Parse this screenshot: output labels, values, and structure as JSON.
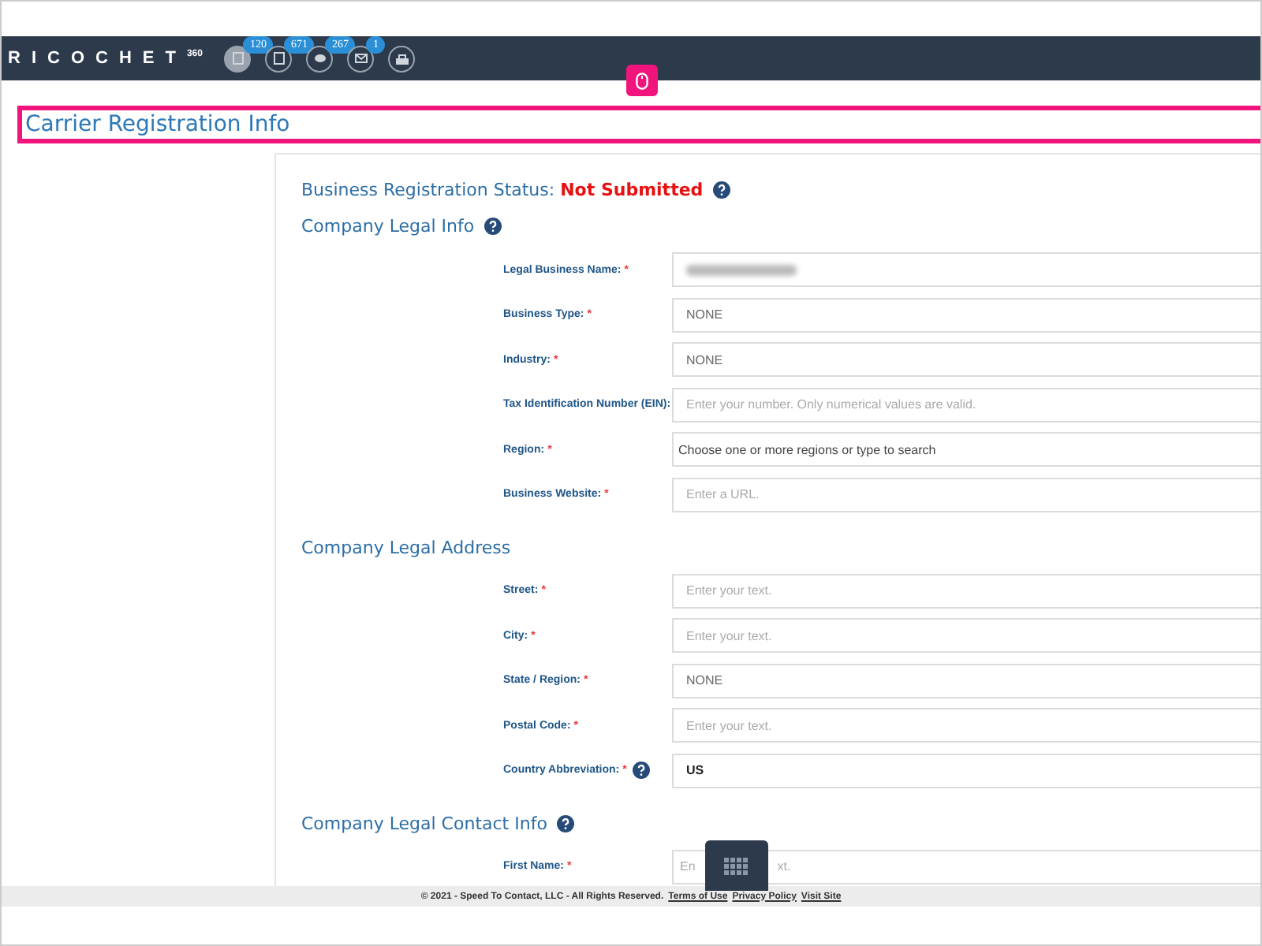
{
  "header": {
    "logo": "RICOCHET",
    "logo_sup": "360",
    "icons": [
      {
        "kind": "doc",
        "badge": "120",
        "selected": true
      },
      {
        "kind": "doc",
        "badge": "671",
        "selected": false
      },
      {
        "kind": "chat",
        "badge": "267",
        "selected": false
      },
      {
        "kind": "mail",
        "badge": "1",
        "selected": false
      },
      {
        "kind": "tray",
        "selected": false
      }
    ]
  },
  "page_title": "Carrier Registration Info",
  "status": {
    "label": "Business Registration Status:",
    "value": "Not Submitted"
  },
  "sections": [
    {
      "title": "Company Legal Info",
      "help": true,
      "fields": [
        {
          "label": "Legal Business Name:",
          "mark": "*",
          "kind": "blurred"
        },
        {
          "label": "Business Type:",
          "mark": "*",
          "kind": "select",
          "value": "NONE"
        },
        {
          "label": "Industry:",
          "mark": "*",
          "kind": "select",
          "value": "NONE"
        },
        {
          "label": "Tax Identification Number (EIN):",
          "kind": "input",
          "placeholder": "Enter your number. Only numerical values are valid."
        },
        {
          "label": "Region:",
          "mark": "*",
          "kind": "multi",
          "placeholder": "Choose one or more regions or type to search"
        },
        {
          "label": "Business Website:",
          "mark": "*",
          "kind": "input",
          "placeholder": "Enter a URL."
        }
      ]
    },
    {
      "title": "Company Legal Address",
      "fields": [
        {
          "label": "Street:",
          "mark": "*",
          "kind": "input",
          "placeholder": "Enter your text."
        },
        {
          "label": "City:",
          "mark": "*",
          "kind": "input",
          "placeholder": "Enter your text."
        },
        {
          "label": "State / Region:",
          "mark": "*",
          "kind": "select",
          "value": "NONE"
        },
        {
          "label": "Postal Code:",
          "mark": "*",
          "kind": "input",
          "placeholder": "Enter your text."
        },
        {
          "label": "Country Abbreviation:",
          "mark": "*",
          "help": true,
          "kind": "strong",
          "value": "US"
        }
      ]
    },
    {
      "title": "Company Legal Contact Info",
      "help": true,
      "fields": [
        {
          "label": "First Name:",
          "mark": "*",
          "kind": "covered",
          "visible_parts": [
            "En",
            "xt."
          ]
        }
      ]
    }
  ],
  "footer": {
    "text": "© 2021 - Speed To Contact, LLC - All Rights Reserved.",
    "links": [
      "Terms of Use",
      "Privacy Policy",
      "Visit Site"
    ]
  }
}
